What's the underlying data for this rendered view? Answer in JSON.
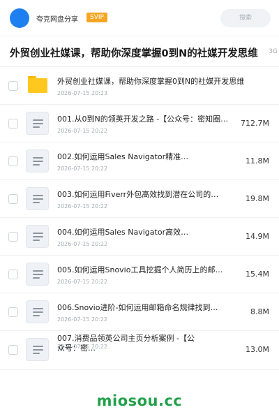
{
  "header": {
    "app_name": "夸克网盘分享",
    "badge": "SVIP",
    "search_placeholder": "搜索",
    "accent_color": "#1e7ff0"
  },
  "page": {
    "title": "外贸创业社媒课，帮助你深度掌握0到N的社媒开发思维",
    "title_tail": "3G"
  },
  "items": [
    {
      "type": "folder",
      "name": "外贸创业社媒课，帮助你深度掌握0到N的社媒开发思维",
      "date": "2026-07-15 20:23",
      "size": ""
    },
    {
      "type": "doc",
      "name": "001.从0到N的领英开发之路 -【公众号：密知圈…",
      "date": "2026-07-15 20:22",
      "size": "712.7M"
    },
    {
      "type": "doc",
      "name": "002.如何运用Sales Navigator精准…",
      "date": "2026-07-15 20:22",
      "size": "11.8M"
    },
    {
      "type": "doc",
      "name": "003.如何运用Fiverr外包高效找到潜在公司的…",
      "date": "2026-07-15 20:22",
      "size": "19.8M"
    },
    {
      "type": "doc",
      "name": "004.如何运用Sales Navigator高效…",
      "date": "2026-07-15 20:22",
      "size": "14.9M"
    },
    {
      "type": "doc",
      "name": "005.如何运用Snovio工具挖掘个人简历上的邮…",
      "date": "2026-07-15 20:22",
      "size": "15.4M"
    },
    {
      "type": "doc",
      "name": "006.Snovio进阶-如何运用邮箱命名规律找到…",
      "date": "2026-07-15 20:22",
      "size": "8.8M"
    },
    {
      "type": "doc",
      "name": "007.消费品领英公司主页分析案例 -【公众号：密…",
      "date": "2026-07-15 20:22",
      "size": "13.0M"
    }
  ],
  "watermark": "miosou.cc"
}
